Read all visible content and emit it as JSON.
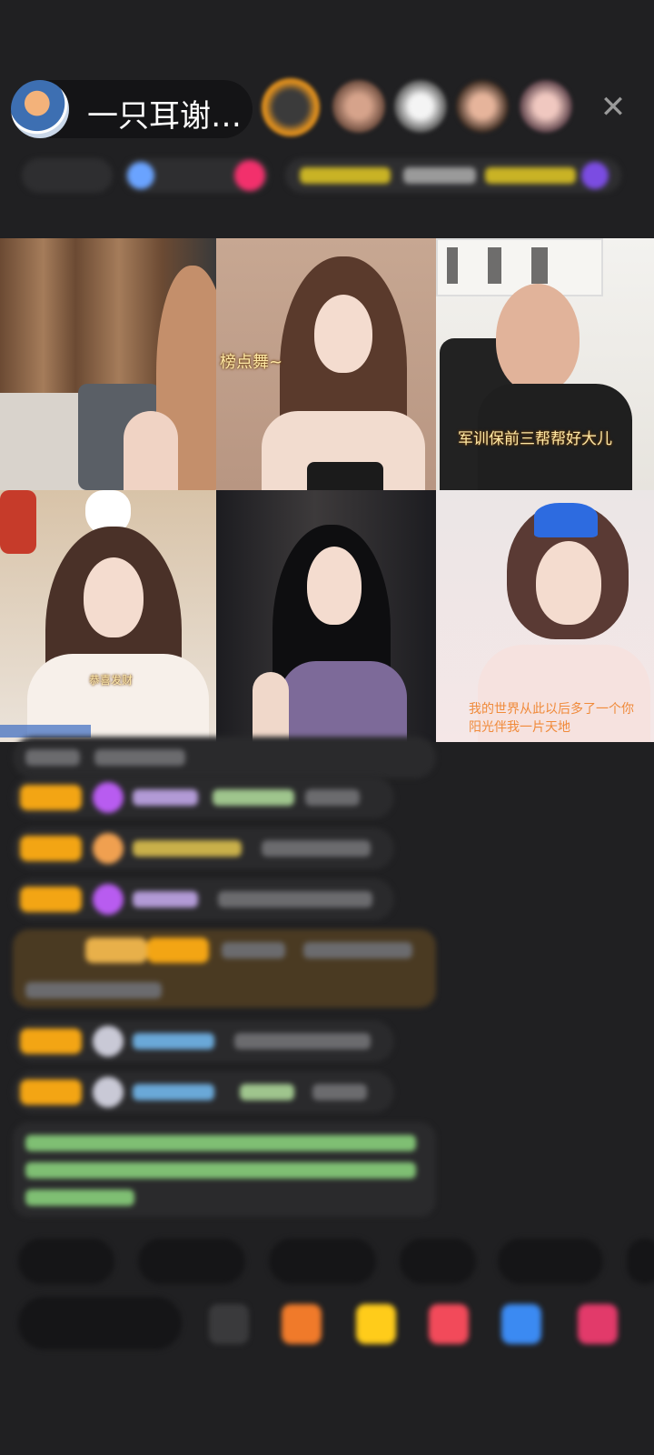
{
  "header": {
    "host_name": "一只耳谢…",
    "close_icon": "close-icon"
  },
  "stream_tiles": [
    {
      "caption": ""
    },
    {
      "caption": "榜点舞~"
    },
    {
      "caption": "军训保前三帮帮好大儿"
    },
    {
      "caption": "",
      "overlay_text": "恭喜发财"
    },
    {
      "caption": ""
    },
    {
      "caption": "我的世界从此以后多了一个你",
      "caption2": "阳光伴我一片天地"
    }
  ],
  "colors": {
    "background": "#202022",
    "badge": "#f3a514",
    "accent_purple": "#b85cf0"
  }
}
